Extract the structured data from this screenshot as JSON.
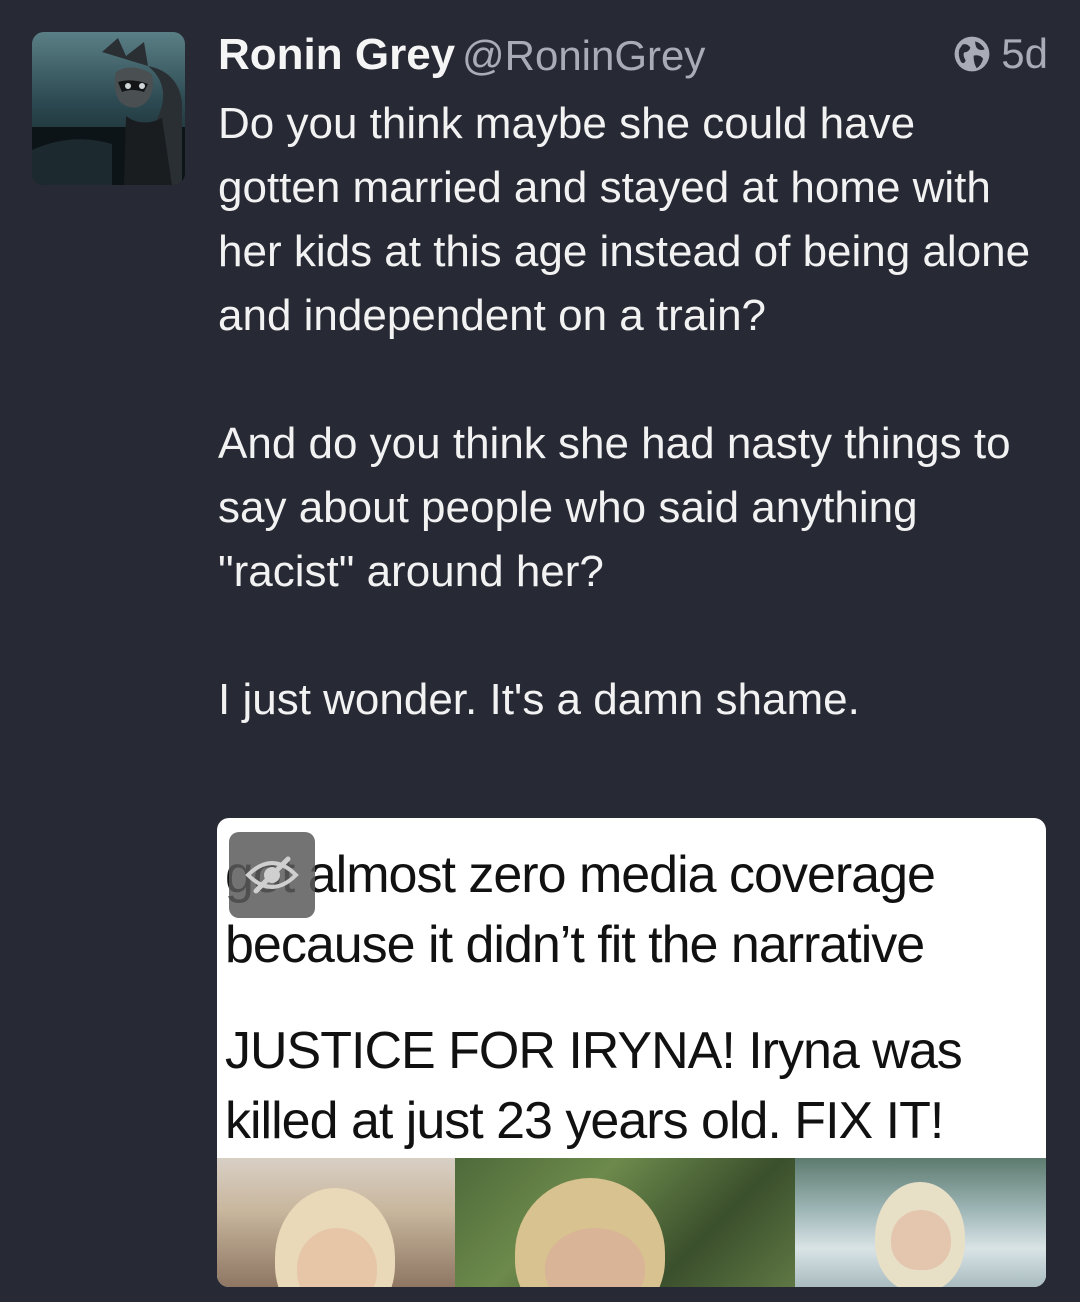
{
  "author": {
    "display_name": "Ronin Grey",
    "handle": "@RoninGrey"
  },
  "meta": {
    "visibility_icon": "globe-icon",
    "time": "5d"
  },
  "post": {
    "paragraphs": [
      "Do you think maybe she could have gotten married and stayed at home with her kids at this age instead of being alone and independent on a train?",
      "And do you think she had nasty things to say about people who said anything \"racist\" around her?",
      "I just wonder. It's a damn shame."
    ]
  },
  "media": {
    "lines": [
      "got almost zero media coverage",
      "because it didn’t fit the narrative",
      "JUSTICE FOR IRYNA! Iryna was",
      "killed at just 23 years old. FIX IT!"
    ],
    "hide_icon": "eye-slash-icon"
  }
}
